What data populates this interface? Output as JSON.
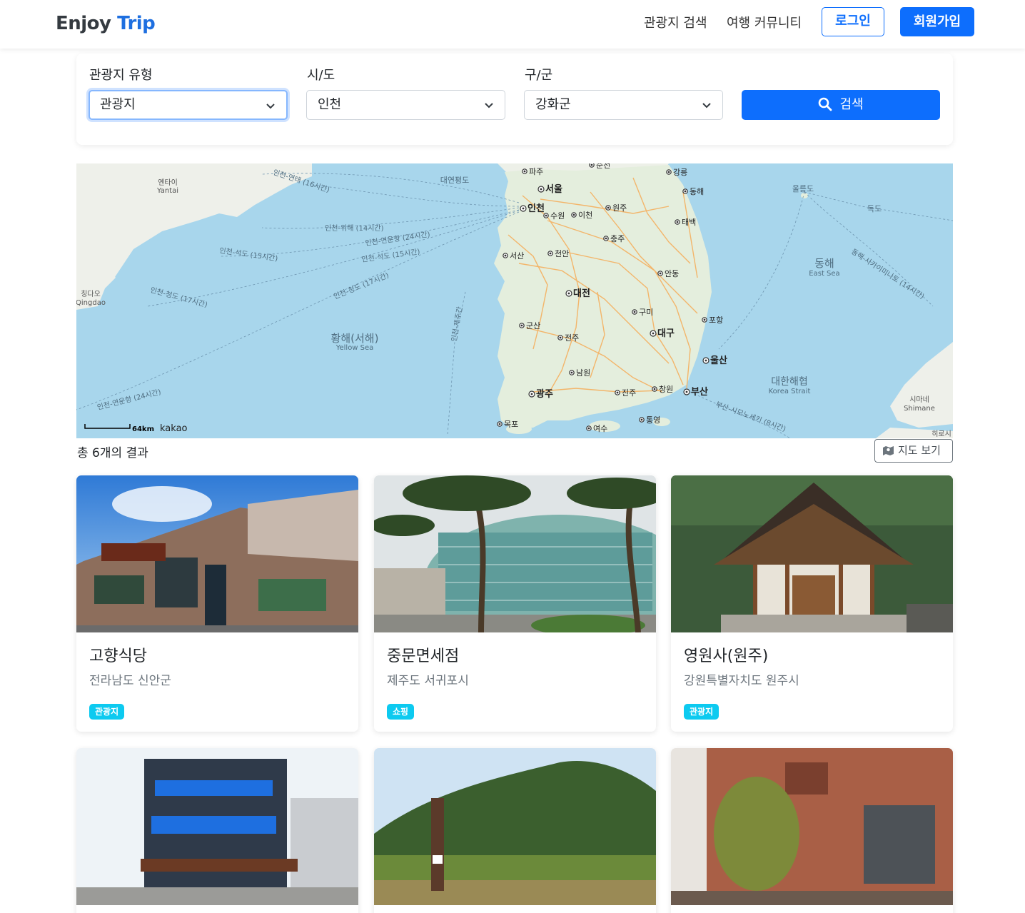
{
  "header": {
    "brand_main": "Enjoy",
    "brand_accent": "Trip",
    "nav": [
      "관광지 검색",
      "여행 커뮤니티"
    ],
    "login": "로그인",
    "signup": "회원가입"
  },
  "search": {
    "type_label": "관광지 유형",
    "type_value": "관광지",
    "sido_label": "시/도",
    "sido_value": "인천",
    "gugun_label": "구/군",
    "gugun_value": "강화군",
    "button": "검색"
  },
  "map": {
    "scale": "64km",
    "logo": "kakao",
    "cities": [
      "파주",
      "서울",
      "인천",
      "수원",
      "이천",
      "원주",
      "충주",
      "서산",
      "천안",
      "대전",
      "구미",
      "대구",
      "군산",
      "전주",
      "포항",
      "울산",
      "남원",
      "광주",
      "진주",
      "창원",
      "부산",
      "목포",
      "여수",
      "통영",
      "강릉",
      "동해",
      "태백",
      "안동",
      "춘천"
    ],
    "labels": {
      "yantai_ko": "옌타이",
      "yantai_en": "Yantai",
      "qingdao_ko": "칭다오",
      "qingdao_en": "Qingdao",
      "yellow_ko": "황해(서해)",
      "yellow_en": "Yellow Sea",
      "east_ko": "동해",
      "east_en": "East Sea",
      "strait_ko": "대한해협",
      "strait_en": "Korea Strait",
      "shimane_ko": "시마네",
      "shimane_en": "Shimane",
      "ulleung": "울릉도",
      "dokdo": "독도",
      "yeonpyeong": "대연평도",
      "hiroshima": "히로시",
      "r1": "인천-연태 (16시간)",
      "r2": "인천-위해 (14시간)",
      "r3": "인천-연운항 (24시간)",
      "r4": "인천-석도 (15시간)",
      "r5": "인천-석도 (15시간)",
      "r6": "인천-청도 (17시간)",
      "r7": "인천-청도 (17시간)",
      "r8": "인천-연운항 (24시간)",
      "r9": "인천-제주간",
      "r10": "동해-사카이미나토 (14시간)",
      "r11": "부산-시모노세키 (8시간)"
    }
  },
  "results": {
    "count_text": "총 6개의 결과",
    "map_button": "지도 보기"
  },
  "cards": [
    {
      "title": "고향식당",
      "location": "전라남도 신안군",
      "badge": "관광지"
    },
    {
      "title": "중문면세점",
      "location": "제주도 서귀포시",
      "badge": "쇼핑"
    },
    {
      "title": "영원사(원주)",
      "location": "강원특별자치도 원주시",
      "badge": "관광지"
    },
    {
      "title": "",
      "location": "",
      "badge": ""
    },
    {
      "title": "",
      "location": "",
      "badge": ""
    },
    {
      "title": "",
      "location": "",
      "badge": ""
    }
  ]
}
